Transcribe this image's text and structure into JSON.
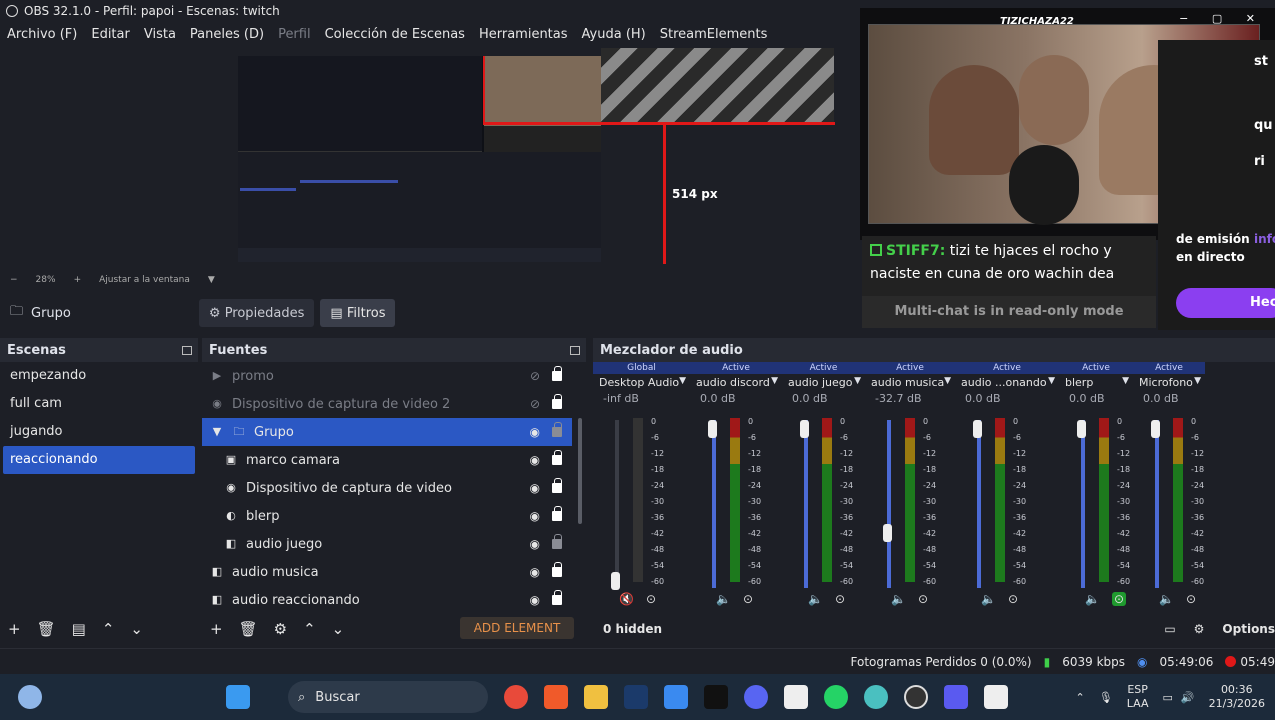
{
  "window": {
    "title": "OBS 32.1.0 - Perfil: papoi - Escenas: twitch"
  },
  "menu": [
    "Archivo (F)",
    "Editar",
    "Vista",
    "Paneles (D)",
    "Perfil",
    "Colección de Escenas",
    "Herramientas",
    "Ayuda (H)",
    "StreamElements"
  ],
  "preview": {
    "measure": "514 px",
    "zoom": "28%",
    "fit": "Ajustar a la ventana"
  },
  "stream": {
    "brand": "TIZICHAZA22",
    "chat_user": "STIFF7:",
    "chat_text": "tizi te hjaces el rocho y naciste en cuna de oro wachin dea",
    "readonly": "Multi-chat is in read-only mode",
    "side_lines": [
      "de emisión",
      "en directo"
    ],
    "side_info": "info",
    "side_button": "Hecho",
    "side_edge": [
      "st",
      "qu",
      "ri"
    ]
  },
  "context": {
    "source": "Grupo",
    "properties": "Propiedades",
    "filters": "Filtros"
  },
  "scenes": {
    "title": "Escenas",
    "items": [
      "empezando",
      "full cam",
      "jugando",
      "reaccionando"
    ],
    "selected": "reaccionando"
  },
  "sources": {
    "title": "Fuentes",
    "items": [
      {
        "label": "promo",
        "icon": "play-icon",
        "hidden": true
      },
      {
        "label": "Dispositivo de captura de video 2",
        "icon": "camera-icon",
        "hidden": true
      },
      {
        "label": "Grupo",
        "icon": "folder-icon",
        "selected": true
      },
      {
        "label": "marco camara",
        "icon": "image-icon",
        "indent": true
      },
      {
        "label": "Dispositivo de captura de video",
        "icon": "camera-icon",
        "indent": true
      },
      {
        "label": "blerp",
        "icon": "globe-icon",
        "indent": true
      },
      {
        "label": "audio juego",
        "icon": "speaker-icon",
        "indent": true
      },
      {
        "label": "audio musica",
        "icon": "speaker-icon"
      },
      {
        "label": "audio reaccionando",
        "icon": "speaker-icon"
      }
    ],
    "add_element": "ADD ELEMENT"
  },
  "mixer": {
    "title": "Mezclador de audio",
    "hidden": "0 hidden",
    "options": "Options",
    "channels": [
      {
        "state": "Global",
        "name": "Desktop Audio",
        "db": "-inf dB",
        "level": 0.05,
        "muted": true
      },
      {
        "state": "Active",
        "name": "audio discord",
        "db": "0.0 dB",
        "level": 1.0
      },
      {
        "state": "Active",
        "name": "audio juego",
        "db": "0.0 dB",
        "level": 1.0
      },
      {
        "state": "Active",
        "name": "audio musica",
        "db": "-32.7 dB",
        "level": 0.35
      },
      {
        "state": "Active",
        "name": "audio ...onando",
        "db": "0.0 dB",
        "level": 1.0
      },
      {
        "state": "Active",
        "name": "blerp",
        "db": "0.0 dB",
        "level": 1.0
      },
      {
        "state": "Active",
        "name": "Microfono",
        "db": "0.0 dB",
        "level": 1.0
      }
    ],
    "scale": [
      "0",
      "-6",
      "-12",
      "-18",
      "-24",
      "-30",
      "-36",
      "-42",
      "-48",
      "-54",
      "-60"
    ]
  },
  "status": {
    "dropped": "Fotogramas Perdidos 0 (0.0%)",
    "bitrate": "6039 kbps",
    "stream_time": "05:49:06",
    "rec_time": "05:49"
  },
  "taskbar": {
    "search": "Buscar",
    "lang": "ESP",
    "region": "LAA",
    "time": "00:36",
    "date": "21/3/2026"
  },
  "colors": {
    "accent": "#2b58c4",
    "active": "#203377",
    "record": "#e01818",
    "twitch": "#8b3ff0"
  }
}
